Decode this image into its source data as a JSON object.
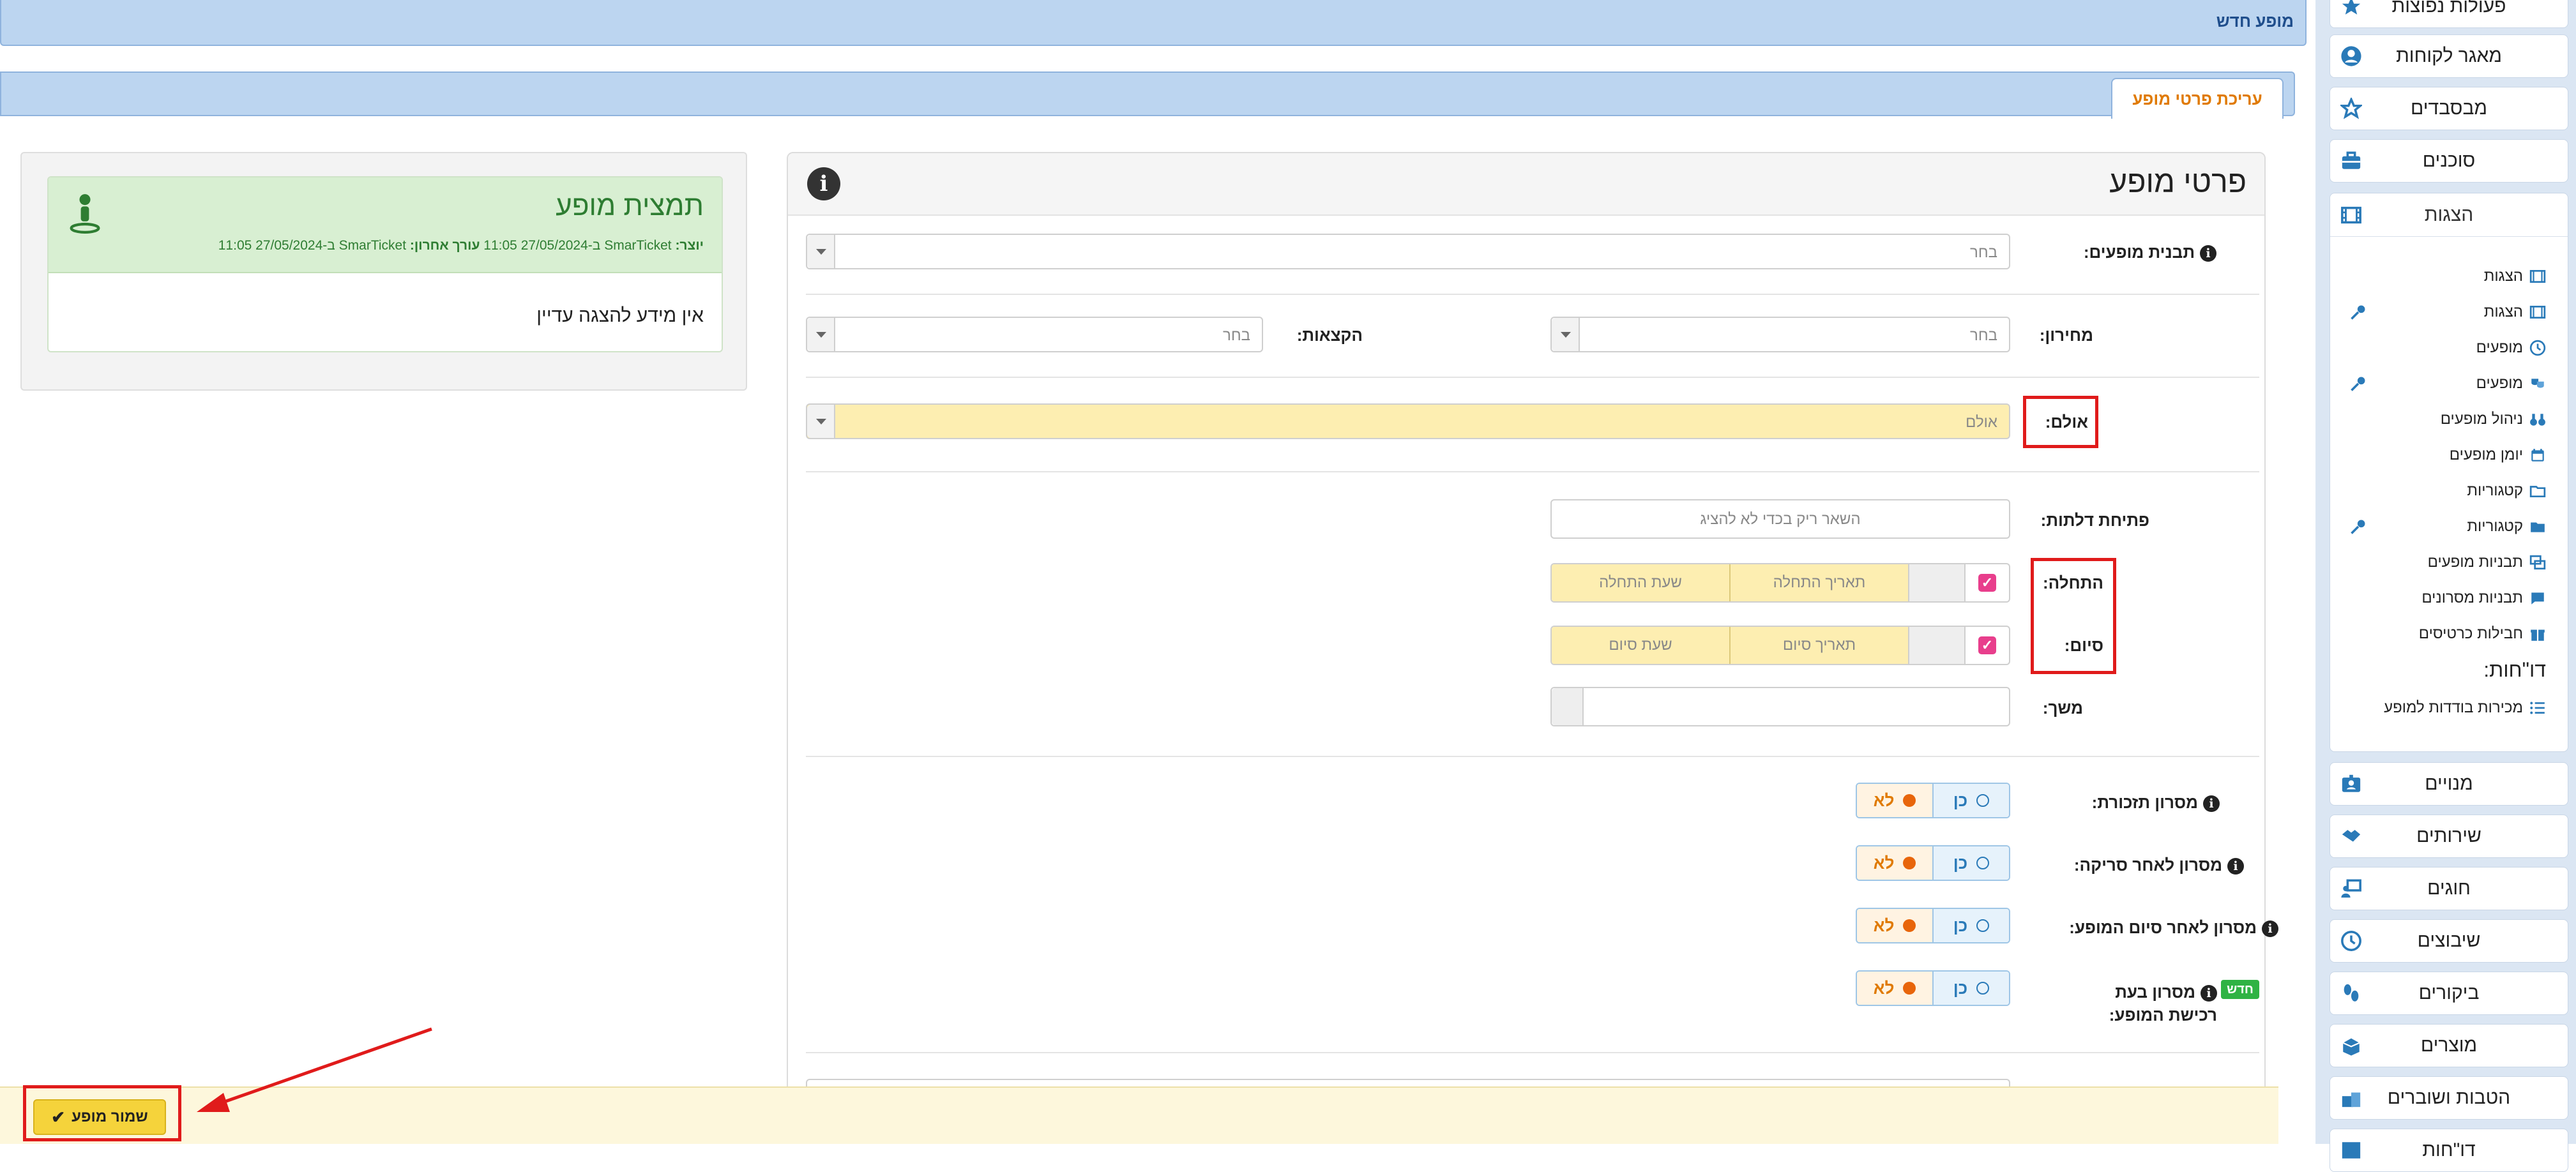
{
  "sidebar": {
    "top_items": [
      "פעולות נפוצות",
      "מאגר לקוחות",
      "מבסבדים",
      "סוכנים"
    ],
    "shows_panel": {
      "title": "הצגות",
      "items": [
        "הצגות",
        "הצגות",
        "מופעים",
        "מופעים",
        "ניהול מופעים",
        "יומן מופעים",
        "קטגוריות",
        "קטגוריות",
        "תבניות מופעים",
        "תבניות מסרונים",
        "חבילות כרטיסים"
      ],
      "reports_title": "דו\"חות:",
      "reports_items": [
        "מכירות בודדות למופע"
      ]
    },
    "bottom_items": [
      "מנויים",
      "שירותים",
      "חוגים",
      "שיבוצים",
      "ביקורים",
      "מוצרים",
      "הטבות ושוברים",
      "דו\"חות"
    ],
    "icon_color": "#2a7ab8"
  },
  "header": {
    "new_event_title": "מופע חדש",
    "tab_edit_label": "עריכת פרטי מופע"
  },
  "details": {
    "title": "פרטי מופע",
    "template_label": "תבנית מופעים:",
    "template_value": "בחר",
    "pricelist_label": "מחירון:",
    "pricelist_value": "בחר",
    "quotas_label": "הקצאות:",
    "quotas_value": "בחר",
    "hall_label": "אולם:",
    "hall_value": "אולם",
    "doors_label": "פתיחת דלתות:",
    "doors_placeholder": "השאר ריק בכדי לא להציג",
    "start_label": "התחלה:",
    "start_date_placeholder": "תאריך התחלה",
    "start_time_placeholder": "שעת התחלה",
    "end_label": "סיום:",
    "end_date_placeholder": "תאריך סיום",
    "end_time_placeholder": "שעת סיום",
    "duration_label": "משך:",
    "sms_reminder_label": "מסרון תזכורת:",
    "sms_after_scan_label": "מסרון לאחר סריקה:",
    "sms_after_end_label": "מסרון לאחר סיום המופע:",
    "sms_on_purchase_label": "מסרון בעת רכישת המופע:",
    "yes_label": "כן",
    "no_label": "לא",
    "new_badge": "חדש"
  },
  "summary": {
    "title": "תמצית מופע",
    "created_by_label": "יוצר:",
    "meta_created": "SmarTicket ב-27/05/2024 11:05",
    "edited_by_label": "עורך אחרון:",
    "meta_edited": "SmarTicket ב-27/05/2024 11:05",
    "empty_text": "אין מידע להצגה עדיין"
  },
  "footer": {
    "save_label": "שמור מופע"
  },
  "colors": {
    "accent_orange": "#e07a00",
    "highlight_yellow": "#fdeeb1",
    "summary_green": "#2e7d32",
    "annotation_red": "#e01b1b"
  }
}
